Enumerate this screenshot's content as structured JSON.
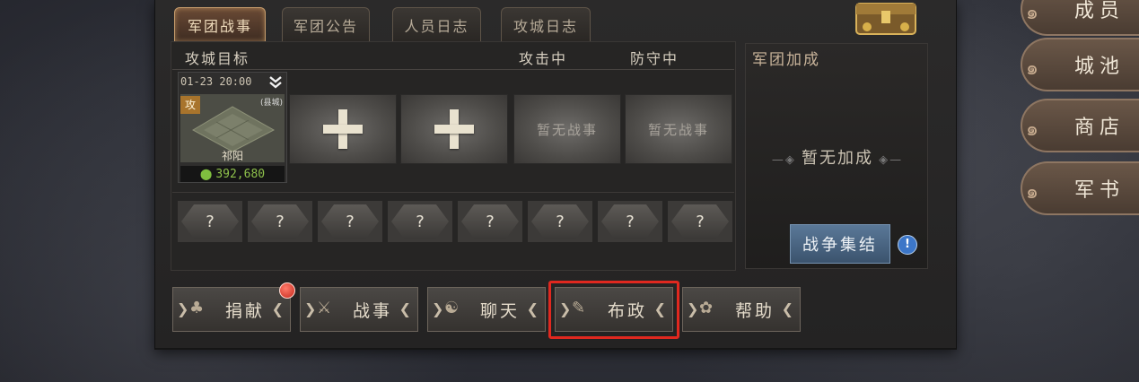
{
  "tabs": [
    "军团战事",
    "军团公告",
    "人员日志",
    "攻城日志"
  ],
  "header": {
    "target": "攻城目标",
    "attacking": "攻击中",
    "defending": "防守中"
  },
  "city": {
    "time": "01-23 20:00",
    "badge": "攻",
    "sub": "(县城)",
    "name": "祁阳",
    "coords": "392,680"
  },
  "slots": {
    "empty_battle": "暂无战事"
  },
  "question_mark": "?",
  "bonus": {
    "title": "军团加成",
    "empty": "暂无加成",
    "rally_button": "战争集结",
    "info": "!"
  },
  "bottom_buttons": [
    "捐献",
    "战事",
    "聊天",
    "布政",
    "帮助"
  ],
  "side_buttons": [
    "成员",
    "城池",
    "商店",
    "军书"
  ]
}
